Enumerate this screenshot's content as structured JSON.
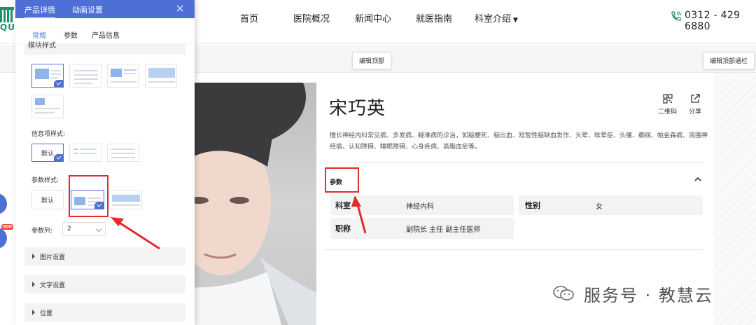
{
  "nav": {
    "logo_text": "QUY",
    "items": [
      "首页",
      "医院概况",
      "新闻中心",
      "就医指南",
      "科室介绍"
    ],
    "phone": "0312 - 429 6880"
  },
  "edit_strip": {
    "left_button": "编辑顶部",
    "right_button": "编辑顶部通栏"
  },
  "doctor": {
    "name": "宋巧英",
    "tools": {
      "qr_label": "二维码",
      "share_label": "分享"
    },
    "description": "擅长神经内科常见病、多发病、疑难病的诊治，如脑梗死、脑出血、短暂性脑缺血发作、头晕、眩晕症、头痛、癫痫、帕金森病、周围神经病、认知障碍、睡眠障碍、心身疾病、高脂血症等。",
    "params_title": "参数",
    "params": [
      {
        "key": "科室",
        "value": "神经内科"
      },
      {
        "key": "性别",
        "value": "女"
      },
      {
        "key": "职称",
        "value": "副院长 主任 副主任医师"
      }
    ]
  },
  "panel": {
    "tabs": [
      "产品详情",
      "动画设置"
    ],
    "sub_tabs": [
      "常规",
      "参数",
      "产品信息"
    ],
    "section_label": "模块样式",
    "info_style_label": "信息项样式:",
    "info_default": "默认",
    "param_style_label": "参数样式:",
    "param_default": "默认",
    "param_cols_label": "参数列:",
    "param_cols_value": "2",
    "accordions": [
      "图片设置",
      "文字设置",
      "位置"
    ],
    "new_badge": "NEW"
  },
  "watermark": "服务号 · 教慧云",
  "colors": {
    "accent": "#4d6fd6",
    "annotation": "#e22b2b",
    "logo": "#1f8f6a"
  }
}
